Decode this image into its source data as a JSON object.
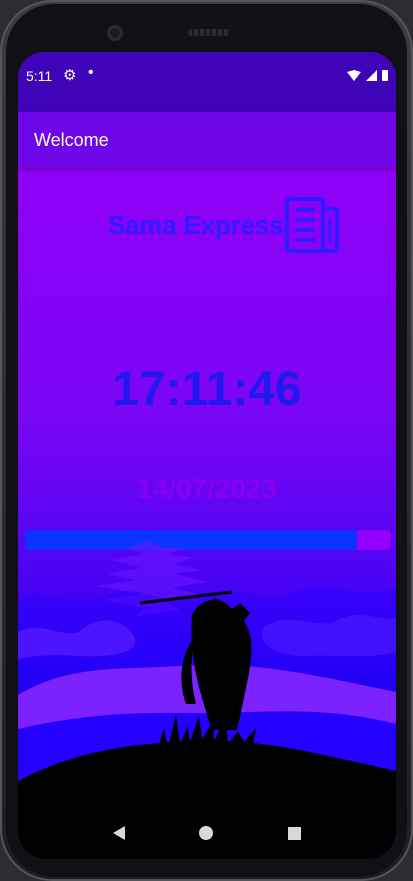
{
  "status_bar": {
    "time": "5:11",
    "settings_icon": "gear-icon",
    "notification_icon": "dot-icon",
    "wifi_icon": "wifi-icon",
    "signal_icon": "signal-icon",
    "battery_icon": "battery-icon"
  },
  "app_bar": {
    "title": "Welcome"
  },
  "main": {
    "brand_name": "Sama Express",
    "brand_icon": "document-icon",
    "clock": "17:11:46",
    "date": "14/07/2023",
    "progress_fraction": 0.906
  },
  "navigation": {
    "back_icon": "back-triangle-icon",
    "home_icon": "home-circle-icon",
    "recents_icon": "recents-square-icon"
  },
  "colors": {
    "status_bar": "#3f04b8",
    "app_bar": "#6f06e7",
    "brand": "#2c1cff",
    "clock": "#2018ef",
    "date": "#8a00ee",
    "progress_fill": "#0b33ff",
    "progress_track": "#9400ff"
  }
}
